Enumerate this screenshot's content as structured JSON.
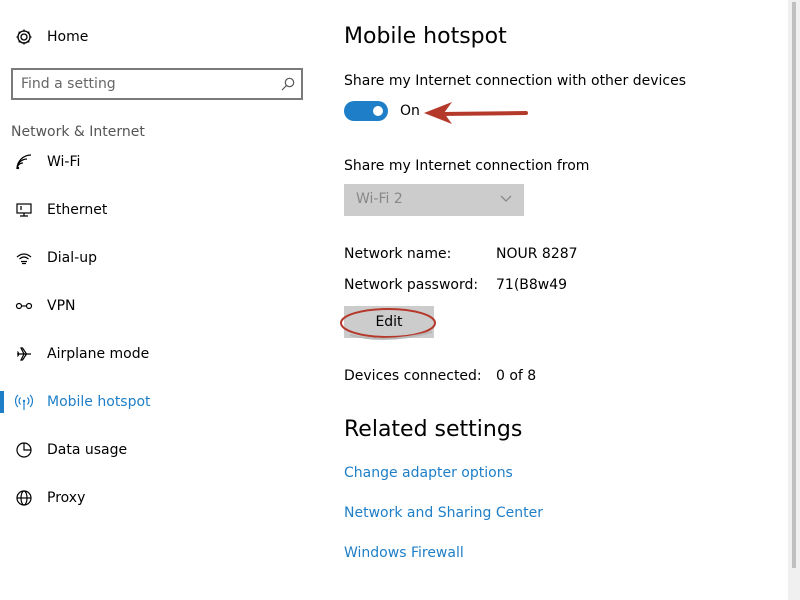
{
  "sidebar": {
    "home_label": "Home",
    "search_placeholder": "Find a setting",
    "section_label": "Network & Internet",
    "items": [
      {
        "label": "Wi-Fi",
        "icon": "wifi-icon"
      },
      {
        "label": "Ethernet",
        "icon": "ethernet-icon"
      },
      {
        "label": "Dial-up",
        "icon": "dialup-icon"
      },
      {
        "label": "VPN",
        "icon": "vpn-icon"
      },
      {
        "label": "Airplane mode",
        "icon": "airplane-icon"
      },
      {
        "label": "Mobile hotspot",
        "icon": "hotspot-icon",
        "active": true
      },
      {
        "label": "Data usage",
        "icon": "data-usage-icon"
      },
      {
        "label": "Proxy",
        "icon": "globe-icon"
      }
    ]
  },
  "main": {
    "title": "Mobile hotspot",
    "share_label": "Share my Internet connection with other devices",
    "toggle_state": "On",
    "share_from_label": "Share my Internet connection from",
    "share_from_value": "Wi-Fi 2",
    "network_name_label": "Network name:",
    "network_name_value": "NOUR 8287",
    "network_password_label": "Network password:",
    "network_password_value": "71(B8w49",
    "edit_label": "Edit",
    "devices_label": "Devices connected:",
    "devices_value": "0 of 8",
    "related_title": "Related settings",
    "links": [
      "Change adapter options",
      "Network and Sharing Center",
      "Windows Firewall"
    ]
  },
  "colors": {
    "accent": "#1e7fc8",
    "annotation": "#b5392b",
    "control_gray": "#cccccc"
  }
}
